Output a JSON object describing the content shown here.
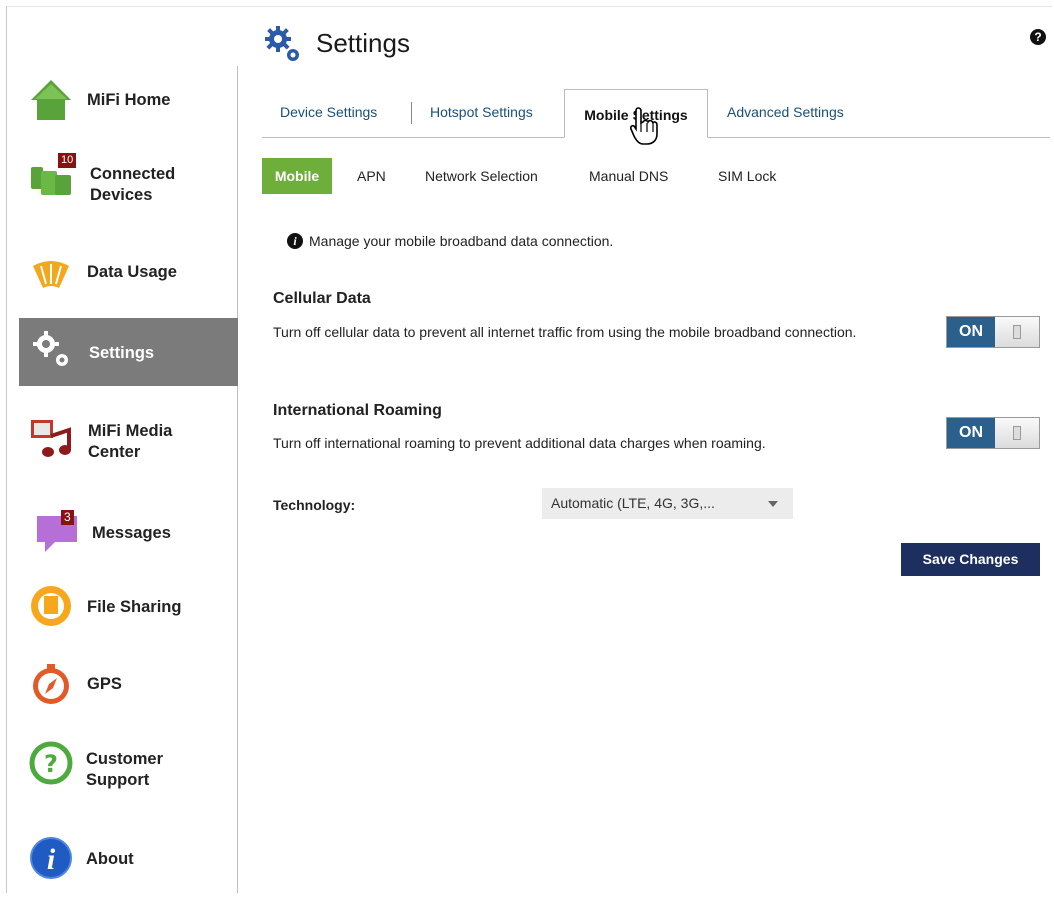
{
  "header": {
    "title": "Settings",
    "help_glyph": "?"
  },
  "sidebar": {
    "items": [
      {
        "label": "MiFi Home",
        "icon": "home-icon"
      },
      {
        "label": "Connected\nDevices",
        "icon": "devices-icon",
        "badge": "10"
      },
      {
        "label": "Data Usage",
        "icon": "data-usage-icon"
      },
      {
        "label": "Settings",
        "icon": "gear-icon",
        "active": true
      },
      {
        "label": "MiFi Media\nCenter",
        "icon": "media-icon"
      },
      {
        "label": "Messages",
        "icon": "messages-icon",
        "badge": "3"
      },
      {
        "label": "File Sharing",
        "icon": "file-sharing-icon"
      },
      {
        "label": "GPS",
        "icon": "compass-icon"
      },
      {
        "label": "Customer\nSupport",
        "icon": "support-icon"
      },
      {
        "label": "About",
        "icon": "info-icon"
      }
    ]
  },
  "tabs": {
    "device": "Device Settings",
    "hotspot": "Hotspot Settings",
    "mobile": "Mobile Settings",
    "advanced": "Advanced Settings",
    "active": "Mobile Settings"
  },
  "subtabs": {
    "mobile": "Mobile",
    "apn": "APN",
    "network": "Network Selection",
    "dns": "Manual DNS",
    "simlock": "SIM Lock",
    "active": "Mobile"
  },
  "content": {
    "info_glyph": "i",
    "info_text": "Manage your mobile broadband data connection.",
    "cellular": {
      "heading": "Cellular Data",
      "desc": "Turn off cellular data to prevent all internet traffic from using the mobile broadband connection.",
      "toggle": "ON"
    },
    "roaming": {
      "heading": "International Roaming",
      "desc": "Turn off international roaming to prevent additional data charges when roaming.",
      "toggle": "ON"
    },
    "technology": {
      "label": "Technology:",
      "value": "Automatic (LTE, 4G, 3G,..."
    },
    "save_label": "Save Changes"
  },
  "colors": {
    "accent_green": "#6eae3a",
    "toggle_blue": "#2b5f8c",
    "save_navy": "#1c2f5e",
    "sidebar_active": "#7b7b7b"
  }
}
